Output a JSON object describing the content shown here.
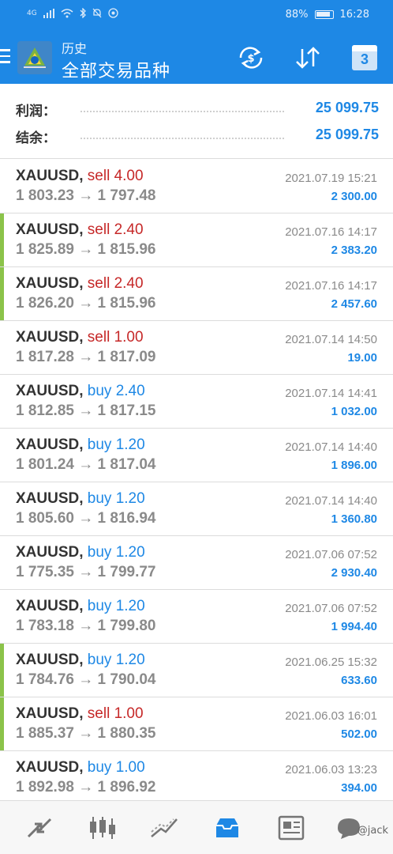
{
  "status_bar": {
    "signal": "4G",
    "battery": "88%",
    "battery_level": 0.88,
    "time": "16:28"
  },
  "app_bar": {
    "subtitle": "历史",
    "title": "全部交易品种",
    "calendar_day": "3",
    "accent_color": "#1e88e5"
  },
  "summary": {
    "profit_label": "利润：",
    "profit_value": "25 099.75",
    "balance_label": "结余：",
    "balance_value": "25 099.75"
  },
  "deals": [
    {
      "symbol": "XAUUSD,",
      "type": "sell",
      "volume": "sell 4.00",
      "open": "1 803.23",
      "close": "1 797.48",
      "time": "2021.07.19 15:21",
      "profit": "2 300.00",
      "marked": false
    },
    {
      "symbol": "XAUUSD,",
      "type": "sell",
      "volume": "sell 2.40",
      "open": "1 825.89",
      "close": "1 815.96",
      "time": "2021.07.16 14:17",
      "profit": "2 383.20",
      "marked": true
    },
    {
      "symbol": "XAUUSD,",
      "type": "sell",
      "volume": "sell 2.40",
      "open": "1 826.20",
      "close": "1 815.96",
      "time": "2021.07.16 14:17",
      "profit": "2 457.60",
      "marked": true
    },
    {
      "symbol": "XAUUSD,",
      "type": "sell",
      "volume": "sell 1.00",
      "open": "1 817.28",
      "close": "1 817.09",
      "time": "2021.07.14 14:50",
      "profit": "19.00",
      "marked": false
    },
    {
      "symbol": "XAUUSD,",
      "type": "buy",
      "volume": "buy 2.40",
      "open": "1 812.85",
      "close": "1 817.15",
      "time": "2021.07.14 14:41",
      "profit": "1 032.00",
      "marked": false
    },
    {
      "symbol": "XAUUSD,",
      "type": "buy",
      "volume": "buy 1.20",
      "open": "1 801.24",
      "close": "1 817.04",
      "time": "2021.07.14 14:40",
      "profit": "1 896.00",
      "marked": false
    },
    {
      "symbol": "XAUUSD,",
      "type": "buy",
      "volume": "buy 1.20",
      "open": "1 805.60",
      "close": "1 816.94",
      "time": "2021.07.14 14:40",
      "profit": "1 360.80",
      "marked": false
    },
    {
      "symbol": "XAUUSD,",
      "type": "buy",
      "volume": "buy 1.20",
      "open": "1 775.35",
      "close": "1 799.77",
      "time": "2021.07.06 07:52",
      "profit": "2 930.40",
      "marked": false
    },
    {
      "symbol": "XAUUSD,",
      "type": "buy",
      "volume": "buy 1.20",
      "open": "1 783.18",
      "close": "1 799.80",
      "time": "2021.07.06 07:52",
      "profit": "1 994.40",
      "marked": false
    },
    {
      "symbol": "XAUUSD,",
      "type": "buy",
      "volume": "buy 1.20",
      "open": "1 784.76",
      "close": "1 790.04",
      "time": "2021.06.25 15:32",
      "profit": "633.60",
      "marked": true
    },
    {
      "symbol": "XAUUSD,",
      "type": "sell",
      "volume": "sell 1.00",
      "open": "1 885.37",
      "close": "1 880.35",
      "time": "2021.06.03 16:01",
      "profit": "502.00",
      "marked": true
    },
    {
      "symbol": "XAUUSD,",
      "type": "buy",
      "volume": "buy 1.00",
      "open": "1 892.98",
      "close": "1 896.92",
      "time": "2021.06.03 13:23",
      "profit": "394.00",
      "marked": false
    }
  ],
  "bottom_nav": {
    "items": [
      "quotes-icon",
      "chart-icon",
      "trade-icon",
      "history-icon",
      "news-icon",
      "messages-icon"
    ],
    "active": "history-icon",
    "watermark": "@jack"
  }
}
